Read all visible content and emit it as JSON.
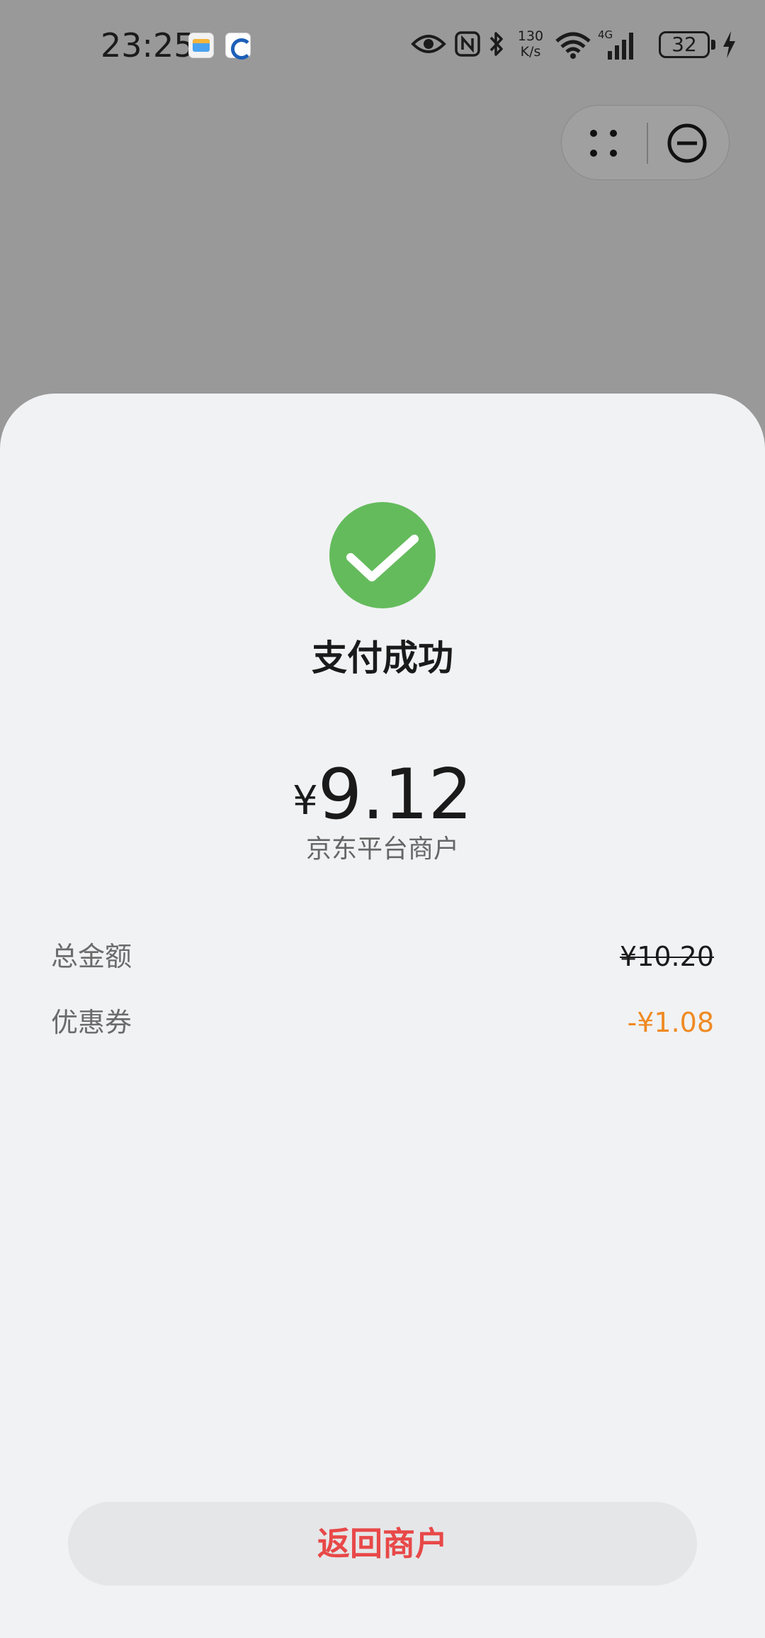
{
  "status_bar": {
    "time": "23:25",
    "network_speed": "130\nK/s",
    "network_speed_value": "130",
    "network_speed_unit": "K/s",
    "network_type": "4G",
    "battery_level": "32",
    "icons": [
      "wallet-icon",
      "bank-app-icon",
      "eye-icon",
      "nfc-icon",
      "bluetooth-icon",
      "wifi-icon",
      "cellular-signal-icon",
      "battery-icon",
      "charging-icon"
    ]
  },
  "capsule": {
    "icons": [
      "more-dots-icon",
      "close-circle-icon"
    ]
  },
  "payment": {
    "status_title": "支付成功",
    "currency_symbol": "¥",
    "amount": "9.12",
    "merchant": "京东平台商户",
    "details": [
      {
        "label": "总金额",
        "value": "¥10.20"
      },
      {
        "label": "优惠券",
        "value": "-¥1.08"
      }
    ],
    "return_button_label": "返回商户"
  },
  "colors": {
    "success_green": "#64bb5c",
    "discount_orange": "#ef8a23",
    "return_red": "#e84848",
    "sheet_background": "#f1f2f4",
    "overlay_gray": "#999999"
  }
}
